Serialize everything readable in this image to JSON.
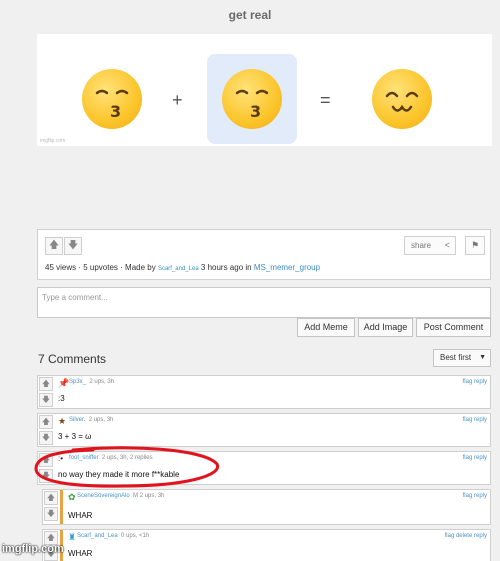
{
  "page": {
    "title": "get real"
  },
  "meme": {
    "watermark": "imgflip.com",
    "plus": "+",
    "equals": "="
  },
  "post": {
    "share_label": "share",
    "meta_stats": "45 views · 5 upvotes · Made by",
    "author": "Scarf_and_Lea",
    "meta_time": "3 hours ago in",
    "stream": "MS_memer_group"
  },
  "comment_input": {
    "placeholder": "Type a comment..."
  },
  "buttons": {
    "add_meme": "Add Meme",
    "add_image": "Add Image",
    "post_comment": "Post Comment"
  },
  "comments_header": {
    "count": "7 Comments",
    "sort": "Best first"
  },
  "comments": [
    {
      "user": "Sp3x_",
      "meta": "2 ups, 3h",
      "actions": "flag reply",
      "text": ":3",
      "avatar": "pin-icon"
    },
    {
      "user": "Silver.",
      "meta": "2 ups, 3h",
      "actions": "flag reply",
      "text": "3 + 3 = ω",
      "avatar": "star-icon"
    },
    {
      "user": "foot_sniffer",
      "meta": "2 ups, 3h, 2 replies",
      "actions": "flag reply",
      "text": "no way they made it more f**kable",
      "avatar": "face-icon"
    },
    {
      "user": "SceneSovereignAlo",
      "meta": "M  2 ups, 3h",
      "actions": "flag reply",
      "text": "WHAR",
      "avatar": "spiral-icon"
    },
    {
      "user": "Scarf_and_Lea",
      "meta": "0 ups, <1h",
      "actions": "flag delete reply",
      "text": "WHAR",
      "avatar": "crown-icon"
    }
  ],
  "footer": {
    "watermark": "imgflip.com"
  },
  "colors": {
    "link": "#3a8ec4",
    "reply_bar": "#e6a442",
    "annotation": "#e0141e"
  }
}
